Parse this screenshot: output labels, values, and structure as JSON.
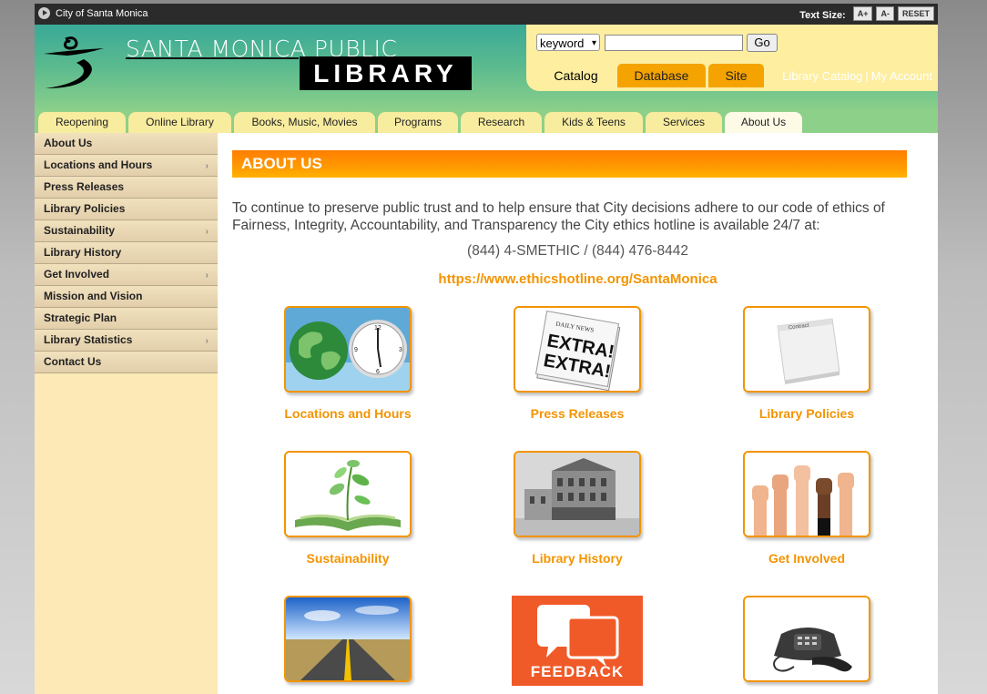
{
  "topbar": {
    "city_link": "City of Santa Monica",
    "text_size_label": "Text Size:",
    "buttons": [
      "A+",
      "A-",
      "RESET"
    ]
  },
  "header": {
    "title_top": "SANTA MONICA PUBLIC",
    "title_bottom": "LIBRARY"
  },
  "search": {
    "select_value": "keyword",
    "input_value": "",
    "go_label": "Go",
    "tabs": [
      {
        "label": "Catalog",
        "active": true
      },
      {
        "label": "Database",
        "active": false
      },
      {
        "label": "Site",
        "active": false
      }
    ],
    "catalog_link": "Library Catalog",
    "separator": "|",
    "account_link": "My Account"
  },
  "nav": {
    "tabs": [
      "Reopening",
      "Online Library",
      "Books, Music, Movies",
      "Programs",
      "Research",
      "Kids & Teens",
      "Services",
      "About Us"
    ],
    "active": "About Us"
  },
  "sidebar": {
    "items": [
      {
        "label": "About Us",
        "arrow": false
      },
      {
        "label": "Locations and Hours",
        "arrow": true
      },
      {
        "label": "Press Releases",
        "arrow": false
      },
      {
        "label": "Library Policies",
        "arrow": false
      },
      {
        "label": "Sustainability",
        "arrow": true
      },
      {
        "label": "Library History",
        "arrow": false
      },
      {
        "label": "Get Involved",
        "arrow": true
      },
      {
        "label": "Mission and Vision",
        "arrow": false
      },
      {
        "label": "Strategic Plan",
        "arrow": false
      },
      {
        "label": "Library Statistics",
        "arrow": true
      },
      {
        "label": "Contact Us",
        "arrow": false
      }
    ],
    "arrow_glyph": "›"
  },
  "main": {
    "heading": "ABOUT US",
    "intro": "To continue to preserve public trust and to help ensure that City decisions adhere to our code of ethics of Fairness, Integrity, Accountability, and Transparency the City ethics hotline is available 24/7 at:",
    "phone": "(844) 4-SMETHIC / (844) 476-8442",
    "hotline_url": "https://www.ethicshotline.org/SantaMonica",
    "tiles": [
      {
        "caption": "Locations and Hours",
        "icon": "globe-clock-icon"
      },
      {
        "caption": "Press Releases",
        "icon": "newspaper-icon"
      },
      {
        "caption": "Library Policies",
        "icon": "contract-icon"
      },
      {
        "caption": "Sustainability",
        "icon": "sprout-book-icon"
      },
      {
        "caption": "Library History",
        "icon": "historic-building-icon"
      },
      {
        "caption": "Get Involved",
        "icon": "raised-hands-icon"
      },
      {
        "caption": "",
        "icon": "road-icon"
      },
      {
        "caption": "",
        "icon": "feedback-icon",
        "label": "FEEDBACK"
      },
      {
        "caption": "",
        "icon": "telephone-icon"
      }
    ]
  },
  "colors": {
    "accent_orange": "#f39400",
    "header_teal": "#3aa998",
    "search_yellow": "#fdeea0",
    "sidebar_tan": "#ecd9b2"
  }
}
